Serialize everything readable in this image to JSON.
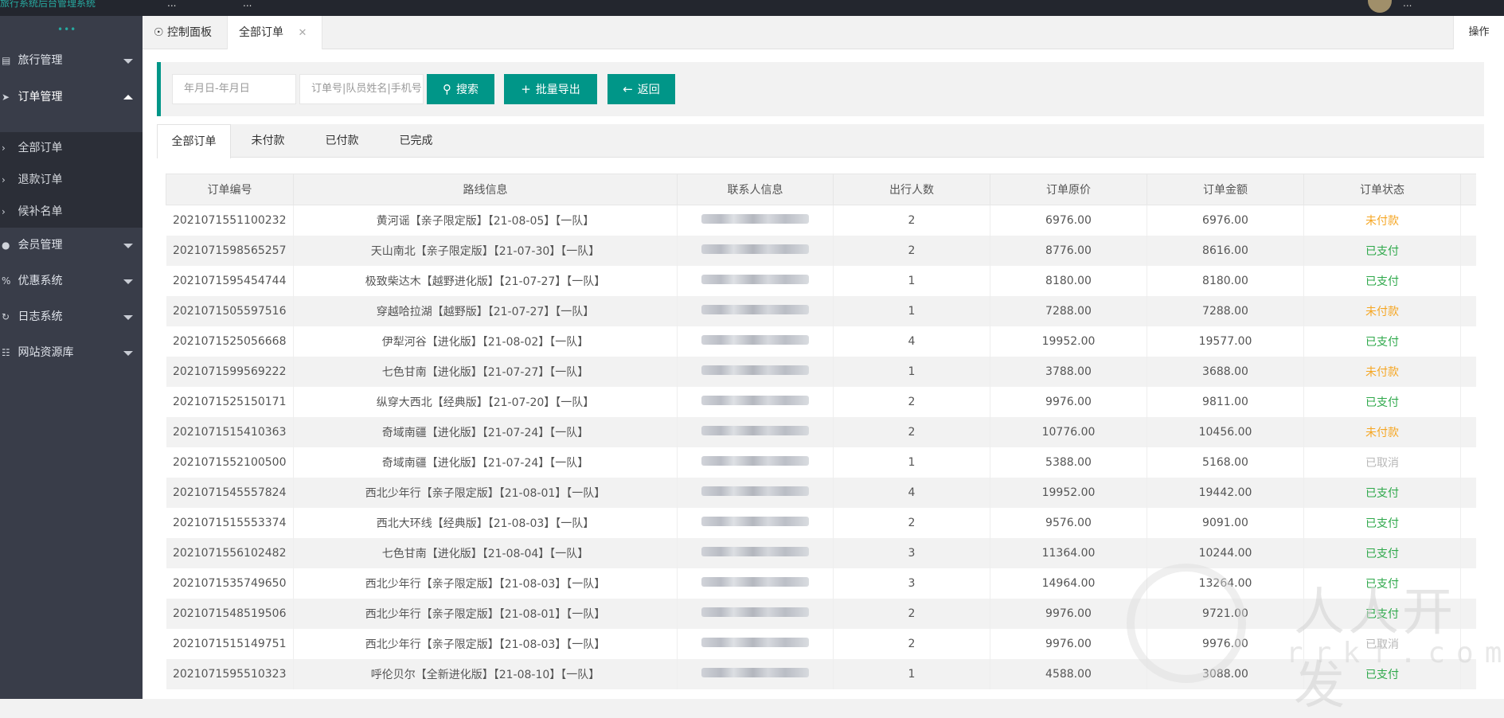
{
  "topbar": {
    "brand": "旅行系统后台管理系统",
    "nav1": "...",
    "nav2": "...",
    "user": "..."
  },
  "sidebar": {
    "dots": "•••",
    "menus": [
      {
        "label": "旅行管理",
        "icon": "map-icon"
      },
      {
        "label": "订单管理",
        "icon": "send-icon"
      },
      {
        "label": "会员管理",
        "icon": "user-icon"
      },
      {
        "label": "优惠系统",
        "icon": "discount-icon"
      },
      {
        "label": "日志系统",
        "icon": "log-icon"
      },
      {
        "label": "网站资源库",
        "icon": "resource-icon"
      }
    ],
    "submenu": [
      "全部订单",
      "退款订单",
      "候补名单"
    ]
  },
  "tabs": {
    "home": "控制面板",
    "active": "全部订单",
    "ops": "操作"
  },
  "search": {
    "date_placeholder": "年月日-年月日",
    "keyword_placeholder": "订单号|队员姓名|手机号",
    "search_btn": "搜索",
    "export_btn": "批量导出",
    "back_btn": "返回"
  },
  "status_tabs": [
    "全部订单",
    "未付款",
    "已付款",
    "已完成"
  ],
  "table": {
    "columns": [
      "订单编号",
      "路线信息",
      "联系人信息",
      "出行人数",
      "订单原价",
      "订单金额",
      "订单状态"
    ],
    "rows": [
      [
        "2021071551100232",
        "黄河谣【亲子限定版】【21-08-05】【一队】",
        "",
        "2",
        "6976.00",
        "6976.00",
        "未付款"
      ],
      [
        "2021071598565257",
        "天山南北【亲子限定版】【21-07-30】【一队】",
        "",
        "2",
        "8776.00",
        "8616.00",
        "已支付"
      ],
      [
        "2021071595454744",
        "极致柴达木【越野进化版】【21-07-27】【一队】",
        "",
        "1",
        "8180.00",
        "8180.00",
        "已支付"
      ],
      [
        "2021071505597516",
        "穿越哈拉湖【越野版】【21-07-27】【一队】",
        "",
        "1",
        "7288.00",
        "7288.00",
        "未付款"
      ],
      [
        "2021071525056668",
        "伊犁河谷【进化版】【21-08-02】【一队】",
        "",
        "4",
        "19952.00",
        "19577.00",
        "已支付"
      ],
      [
        "2021071599569222",
        "七色甘南【进化版】【21-07-27】【一队】",
        "",
        "1",
        "3788.00",
        "3688.00",
        "未付款"
      ],
      [
        "2021071525150171",
        "纵穿大西北【经典版】【21-07-20】【一队】",
        "",
        "2",
        "9976.00",
        "9811.00",
        "已支付"
      ],
      [
        "2021071515410363",
        "奇域南疆【进化版】【21-07-24】【一队】",
        "",
        "2",
        "10776.00",
        "10456.00",
        "未付款"
      ],
      [
        "2021071552100500",
        "奇域南疆【进化版】【21-07-24】【一队】",
        "",
        "1",
        "5388.00",
        "5168.00",
        "已取消"
      ],
      [
        "2021071545557824",
        "西北少年行【亲子限定版】【21-08-01】【一队】",
        "",
        "4",
        "19952.00",
        "19442.00",
        "已支付"
      ],
      [
        "2021071515553374",
        "西北大环线【经典版】【21-08-03】【一队】",
        "",
        "2",
        "9576.00",
        "9091.00",
        "已支付"
      ],
      [
        "2021071556102482",
        "七色甘南【进化版】【21-08-04】【一队】",
        "",
        "3",
        "11364.00",
        "10244.00",
        "已支付"
      ],
      [
        "2021071535749650",
        "西北少年行【亲子限定版】【21-08-03】【一队】",
        "",
        "3",
        "14964.00",
        "13264.00",
        "已支付"
      ],
      [
        "2021071548519506",
        "西北少年行【亲子限定版】【21-08-01】【一队】",
        "",
        "2",
        "9976.00",
        "9721.00",
        "已支付"
      ],
      [
        "2021071515149751",
        "西北少年行【亲子限定版】【21-08-03】【一队】",
        "",
        "2",
        "9976.00",
        "9976.00",
        "已取消"
      ],
      [
        "2021071595510323",
        "呼伦贝尔【全新进化版】【21-08-10】【一队】",
        "",
        "1",
        "4588.00",
        "3088.00",
        "已支付"
      ]
    ]
  },
  "watermark": {
    "text": "人人开发",
    "sub": "rrkf.com"
  },
  "colors": {
    "accent": "#009688",
    "unpaid": "#f5a623",
    "paid": "#2ea84a",
    "cancelled": "#b8b8b8",
    "sidebar": "#393d49"
  }
}
